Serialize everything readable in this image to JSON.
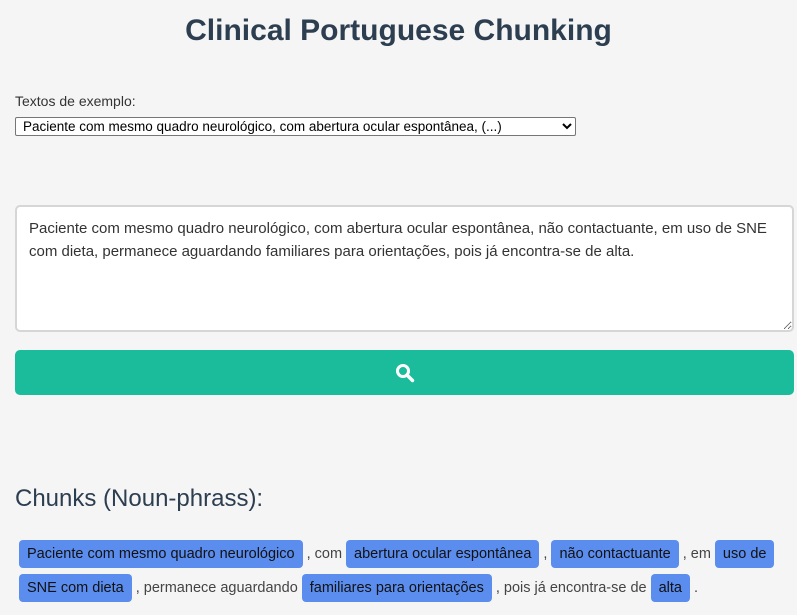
{
  "page": {
    "title": "Clinical Portuguese Chunking"
  },
  "examples": {
    "label": "Textos de exemplo:",
    "selected": "Paciente com mesmo quadro neurológico, com abertura ocular espontânea, (...)"
  },
  "input": {
    "text": "Paciente com mesmo quadro neurológico, com abertura ocular espontânea, não contactuante, em uso de SNE com dieta, permanece aguardando familiares para orientações, pois já encontra-se de alta."
  },
  "submit": {
    "icon": "search-icon"
  },
  "chunks": {
    "heading": "Chunks (Noun-phrass):",
    "parts": [
      {
        "type": "np",
        "text": "Paciente com mesmo quadro neurológico"
      },
      {
        "type": "text",
        "text": ", com"
      },
      {
        "type": "np",
        "text": "abertura ocular espontânea"
      },
      {
        "type": "text",
        "text": ","
      },
      {
        "type": "np",
        "text": "não contactuante"
      },
      {
        "type": "text",
        "text": ", em"
      },
      {
        "type": "np",
        "text": "uso de SNE com dieta"
      },
      {
        "type": "text",
        "text": ", permanece aguardando"
      },
      {
        "type": "np",
        "text": "familiares para orientações"
      },
      {
        "type": "text",
        "text": ", pois já encontra-se de"
      },
      {
        "type": "np",
        "text": "alta"
      },
      {
        "type": "text",
        "text": "."
      }
    ],
    "colors": {
      "noun_phrase": "#5b8def",
      "button": "#1abc9c"
    }
  }
}
